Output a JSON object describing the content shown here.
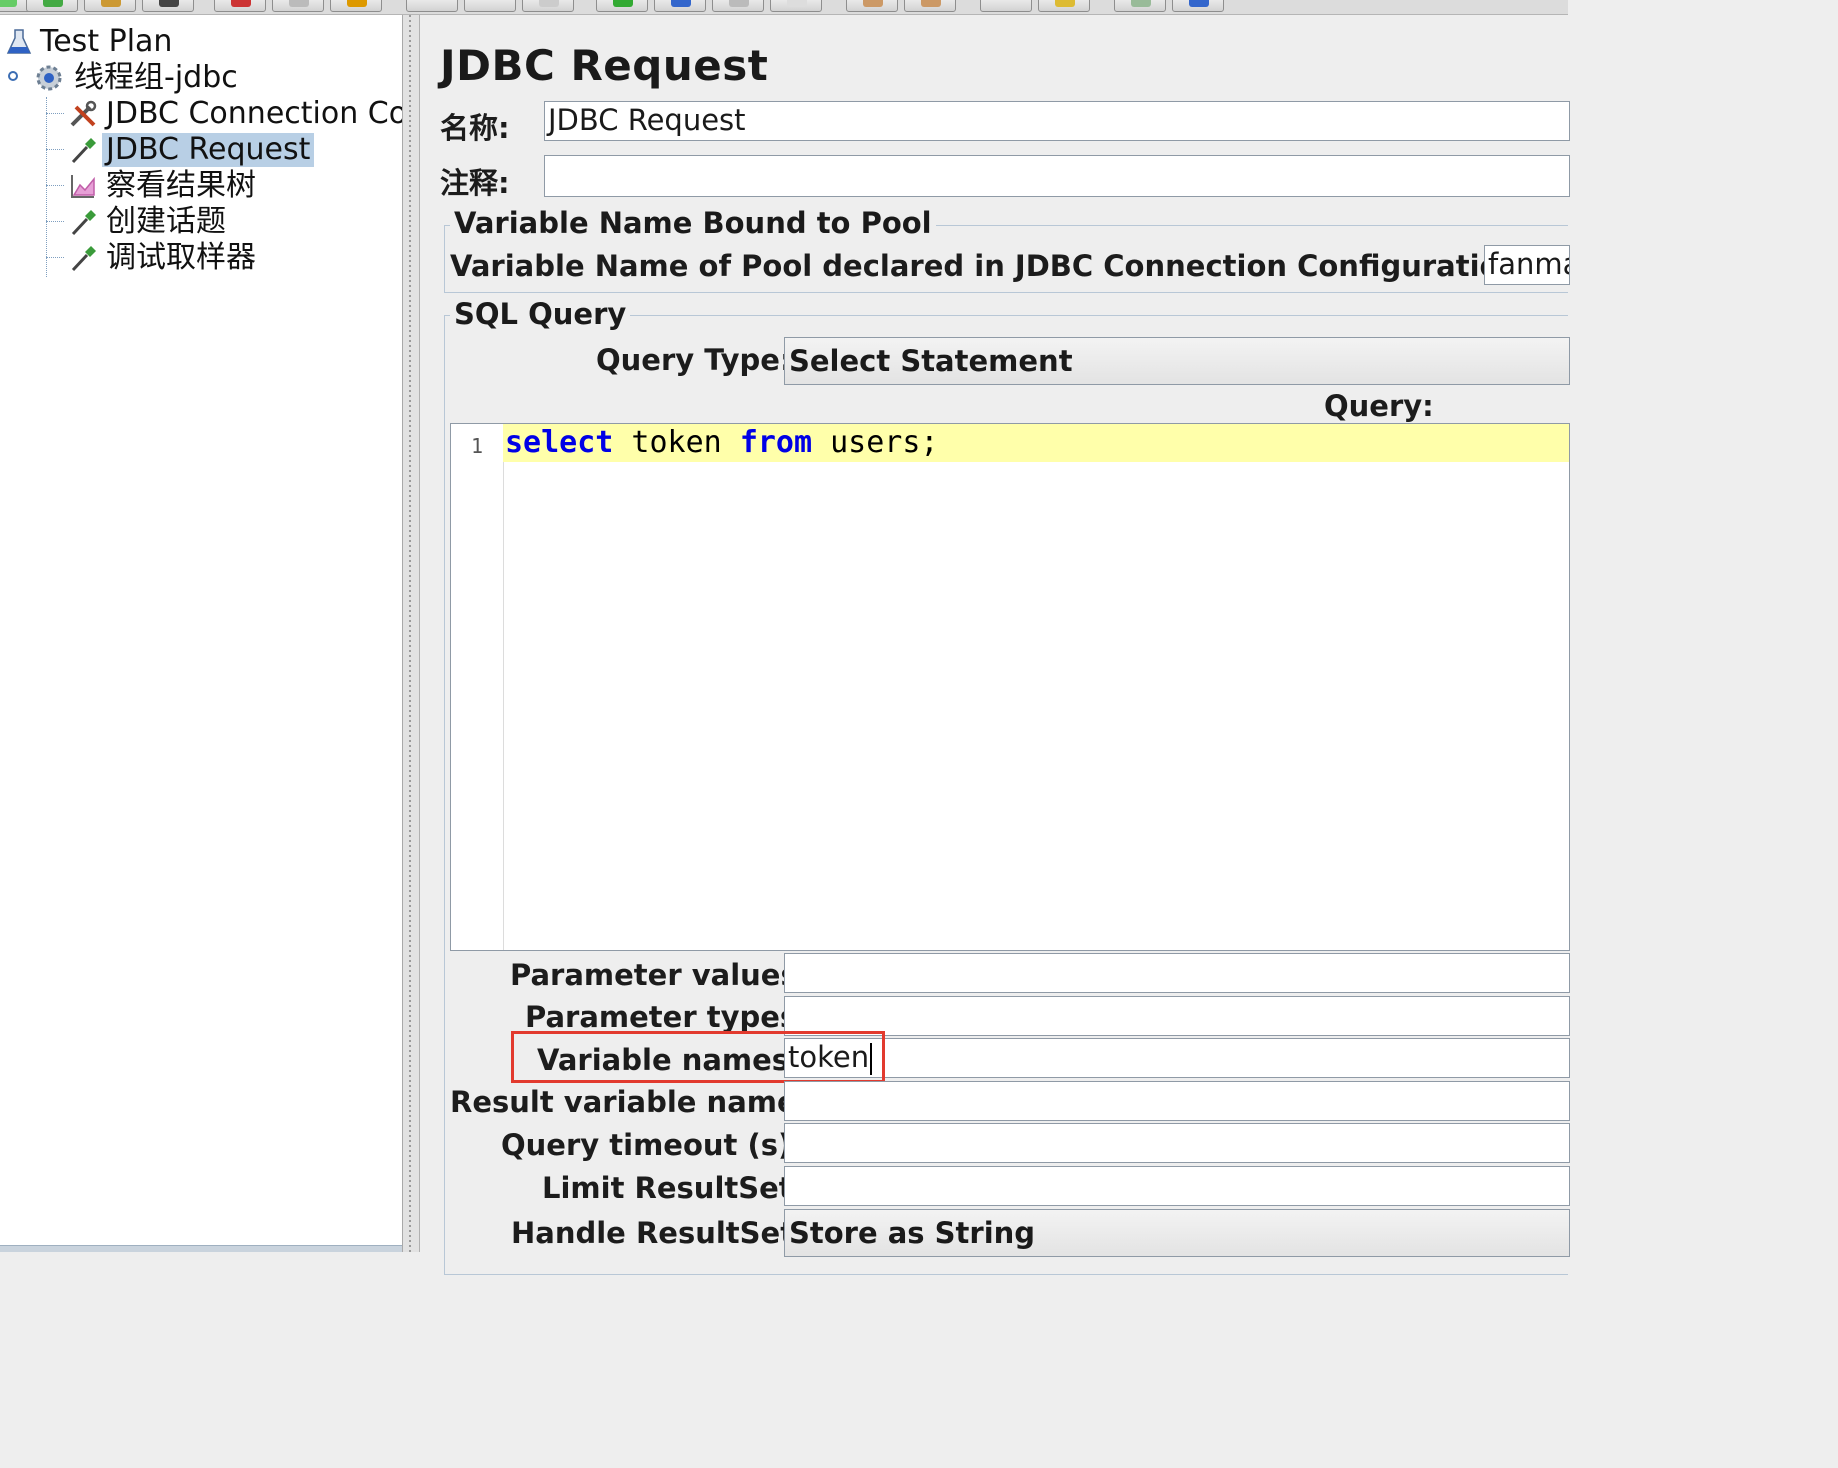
{
  "toolbar": {
    "buttons": [
      "new-icon",
      "templates-icon",
      "open-icon",
      "save-icon",
      "cut-icon",
      "copy-icon",
      "paste-icon",
      "expand-icon",
      "collapse-icon",
      "toggle-icon",
      "start-icon",
      "start-no-pause-icon",
      "stop-icon",
      "shutdown-icon",
      "clear-icon",
      "clear-all-icon",
      "search-icon",
      "reset-search-icon",
      "function-helper-icon",
      "help-icon"
    ]
  },
  "tree": {
    "items": [
      {
        "label": "Test Plan",
        "icon": "flask-icon"
      },
      {
        "label": "线程组-jdbc",
        "icon": "gear-icon"
      },
      {
        "label": "JDBC Connection Co",
        "icon": "wrench-icon"
      },
      {
        "label": "JDBC Request",
        "icon": "pipette-icon",
        "selected": true
      },
      {
        "label": "察看结果树",
        "icon": "chart-icon"
      },
      {
        "label": "创建话题",
        "icon": "pipette-icon"
      },
      {
        "label": "调试取样器",
        "icon": "pipette-icon"
      }
    ]
  },
  "panel": {
    "title": "JDBC Request",
    "name_label": "名称:",
    "name_value": "JDBC Request",
    "comment_label": "注释:",
    "comment_value": "",
    "pool_group_title": "Variable Name Bound to Pool",
    "pool_label": "Variable Name of Pool declared in JDBC Connection Configuration:",
    "pool_value": "fanma",
    "sql_group_title": "SQL Query",
    "query_type_label": "Query Type:",
    "query_type_value": "Select Statement",
    "query_label": "Query:",
    "query_line_number": "1",
    "query_tokens": {
      "kw1": "select",
      "t1": " token ",
      "kw2": "from",
      "t2": " users;"
    },
    "param_values_label": "Parameter values:",
    "param_values_value": "",
    "param_types_label": "Parameter types:",
    "param_types_value": "",
    "variable_names_label": "Variable names:",
    "variable_names_value": "token",
    "result_var_label": "Result variable name:",
    "result_var_value": "",
    "query_timeout_label": "Query timeout (s):",
    "query_timeout_value": "",
    "limit_resultset_label": "Limit ResultSet:",
    "limit_resultset_value": "",
    "handle_resultset_label": "Handle ResultSet:",
    "handle_resultset_value": "Store as String"
  },
  "colors": {
    "selection": "#b8cfe5",
    "keyword": "#0000e6",
    "current_line": "#ffffaa",
    "annotation_box": "#e23a2e"
  }
}
